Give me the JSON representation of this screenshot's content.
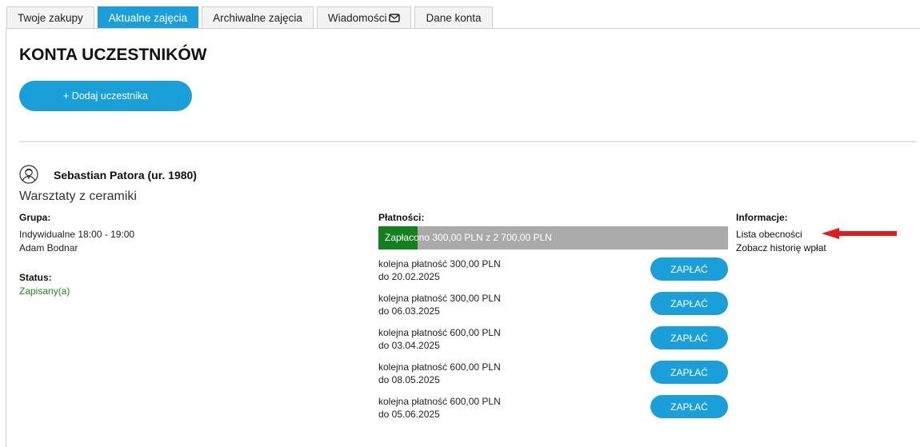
{
  "tabs": [
    {
      "label": "Twoje zakupy",
      "active": false
    },
    {
      "label": "Aktualne zajęcia",
      "active": true
    },
    {
      "label": "Archiwalne zajęcia",
      "active": false
    },
    {
      "label": "Wiadomości",
      "active": false,
      "icon": "envelope-icon"
    },
    {
      "label": "Dane konta",
      "active": false
    }
  ],
  "page_title": "KONTA UCZESTNIKÓW",
  "add_participant_label": "+ Dodaj uczestnika",
  "participant": {
    "name": "Sebastian Patora (ur. 1980)",
    "avatar_icon": "user-avatar-icon",
    "course": "Warsztaty z ceramiki",
    "group_label": "Grupa:",
    "group_time": "Indywidualne 18:00 - 19:00",
    "instructor": "Adam Bodnar",
    "status_label": "Status:",
    "status_value": "Zapisany(a)",
    "status_color": "#1e8a1e"
  },
  "payments": {
    "label": "Płatności:",
    "summary": "Zapłacono 300,00 PLN z 2 700,00 PLN",
    "paid_fraction": 0.111,
    "paid_color": "#12801f",
    "remaining_color": "#aaaaaa",
    "pay_label": "ZAPŁAĆ",
    "installments": [
      {
        "title": "kolejna płatność 300,00 PLN",
        "due": "do 20.02.2025"
      },
      {
        "title": "kolejna płatność 300,00 PLN",
        "due": "do 06.03.2025"
      },
      {
        "title": "kolejna płatność 600,00 PLN",
        "due": "do 03.04.2025"
      },
      {
        "title": "kolejna płatność 600,00 PLN",
        "due": "do 08.05.2025"
      },
      {
        "title": "kolejna płatność 600,00 PLN",
        "due": "do 05.06.2025"
      }
    ]
  },
  "info": {
    "label": "Informacje:",
    "attendance_link": "Lista obecności",
    "history_link": "Zobacz historię wpłat"
  },
  "annotation": {
    "icon": "red-arrow-icon",
    "color": "#e21b1b"
  },
  "accent_color": "#1a9fd9"
}
